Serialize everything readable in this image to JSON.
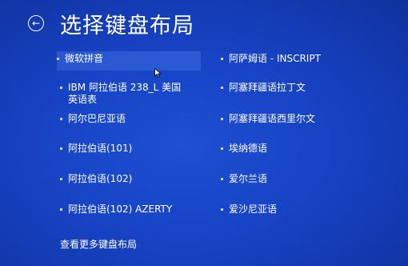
{
  "page": {
    "title": "选择键盘布局",
    "more_link": "查看更多键盘布局"
  },
  "left_options": [
    {
      "lines": [
        "微软拼音"
      ],
      "highlighted": true
    },
    {
      "lines": [
        "IBM 阿拉伯语 238_L 美国",
        "英语表"
      ],
      "highlighted": false
    },
    {
      "lines": [
        "阿尔巴尼亚语"
      ],
      "highlighted": false
    },
    {
      "lines": [
        "阿拉伯语(101)"
      ],
      "highlighted": false
    },
    {
      "lines": [
        "阿拉伯语(102)"
      ],
      "highlighted": false
    },
    {
      "lines": [
        "阿拉伯语(102) AZERTY"
      ],
      "highlighted": false
    }
  ],
  "right_options": [
    {
      "lines": [
        "阿萨姆语 - INSCRIPT"
      ]
    },
    {
      "lines": [
        "阿塞拜疆语拉丁文"
      ]
    },
    {
      "lines": [
        "阿塞拜疆语西里尔文"
      ]
    },
    {
      "lines": [
        "埃纳德语"
      ]
    },
    {
      "lines": [
        "爱尔兰语"
      ]
    },
    {
      "lines": [
        "爱沙尼亚语"
      ]
    }
  ],
  "icons": {
    "back": "arrow-left-circle-icon",
    "option_bullet": "bullet-icon",
    "cursor": "mouse-pointer-icon"
  },
  "colors": {
    "background": "#1743c4",
    "highlight": "#5082f0",
    "text": "#ffffff"
  }
}
